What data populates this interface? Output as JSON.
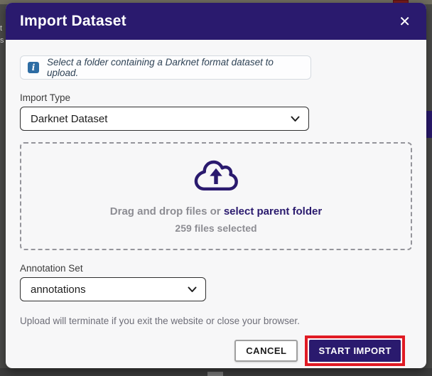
{
  "modal": {
    "title": "Import Dataset",
    "close_glyph": "✕"
  },
  "info": {
    "icon_glyph": "i",
    "text": "Select a folder containing a Darknet format dataset to upload."
  },
  "import_type": {
    "label": "Import Type",
    "value": "Darknet Dataset"
  },
  "dropzone": {
    "drag_text": "Drag and drop files or ",
    "link_text": "select parent folder",
    "status_text": "259 files selected"
  },
  "annotation_set": {
    "label": "Annotation Set",
    "value": "annotations"
  },
  "note": {
    "text": "Upload will terminate if you exit the website or close your browser."
  },
  "footer": {
    "cancel_label": "CANCEL",
    "start_label": "START IMPORT"
  },
  "backdrop": {
    "edge_text_top": "t",
    "edge_text_bottom": "s"
  },
  "colors": {
    "accent_indigo": "#2a1a6e",
    "highlight_red": "#e01b24",
    "info_icon_blue": "#2e6da4",
    "muted_gray": "#8d8d93"
  }
}
